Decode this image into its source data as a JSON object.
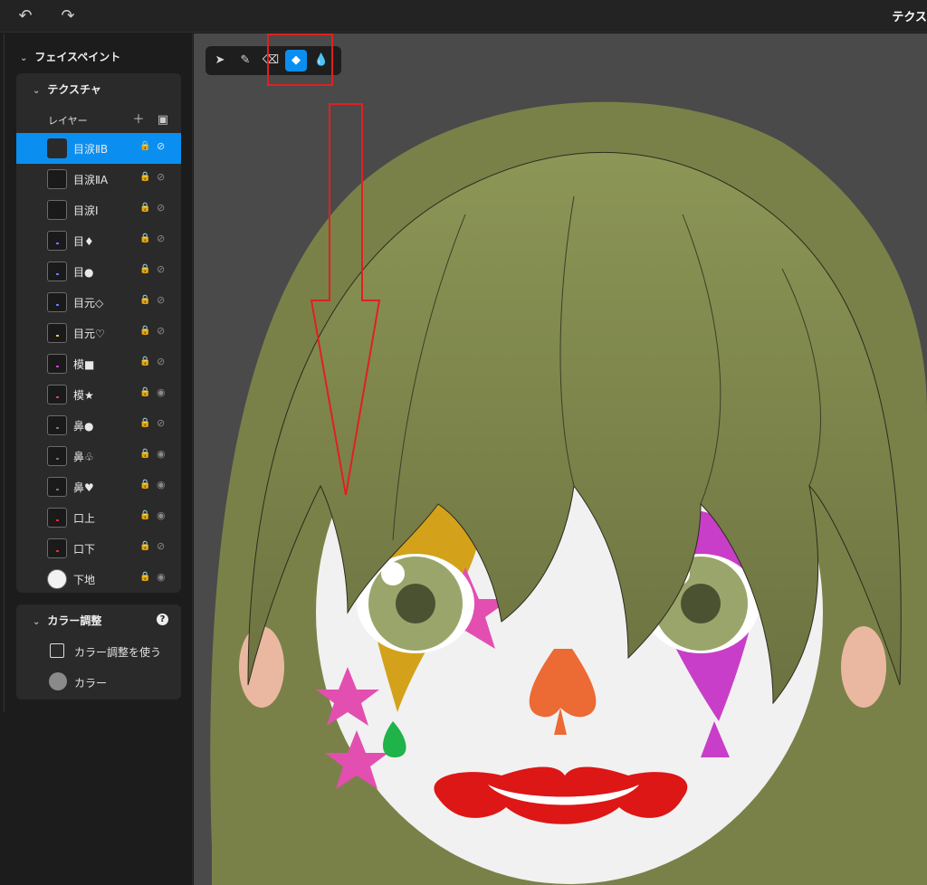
{
  "topbar": {
    "undo_icon": "undo-icon",
    "redo_icon": "redo-icon",
    "title": "テクス"
  },
  "sidebar": {
    "section_title": "フェイスペイント",
    "texture": {
      "title": "テクスチャ",
      "layers_label": "レイヤー",
      "layers": [
        {
          "name": "目涙ⅡB",
          "selected": true
        },
        {
          "name": "目涙ⅡA"
        },
        {
          "name": "目涙Ⅰ"
        },
        {
          "name": "目♦"
        },
        {
          "name": "目●"
        },
        {
          "name": "目元◇"
        },
        {
          "name": "目元♡"
        },
        {
          "name": "模■"
        },
        {
          "name": "模★"
        },
        {
          "name": "鼻●"
        },
        {
          "name": "鼻♧"
        },
        {
          "name": "鼻♥"
        },
        {
          "name": "口上"
        },
        {
          "name": "口下"
        },
        {
          "name": "下地"
        }
      ]
    },
    "color_adjust": {
      "title": "カラー調整",
      "use_label": "カラー調整を使う",
      "color_label": "カラー"
    }
  },
  "toolbar": {
    "tools": [
      "select-tool",
      "pen-tool",
      "eraser-tool",
      "fill-tool",
      "drop-tool"
    ],
    "active": "fill-tool"
  },
  "colors": {
    "accent": "#0a8ff0",
    "annotation": "#e02020",
    "hair": "#7f8a4a",
    "skin": "#f1f1f1"
  }
}
